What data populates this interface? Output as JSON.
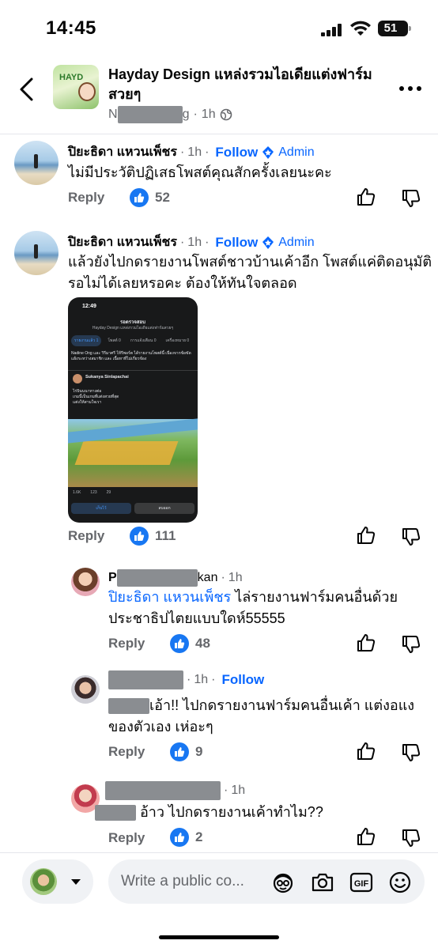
{
  "status_bar": {
    "time": "14:45",
    "battery": "51"
  },
  "header": {
    "title": "Hayday Design แหล่งรวมไอเดียแต่งฟาร์มสวยๆ",
    "author_prefix": "N",
    "author_suffix": "g",
    "time": "1h",
    "avatar_text": "HAYD"
  },
  "comments": [
    {
      "name": "ปิยะธิดา แหวนเพ็ชร",
      "time": "1h",
      "follow": "Follow",
      "badge": "Admin",
      "text": "ไม่มีประวัติปฏิเสธโพสต์คุณสักครั้งเลยนะคะ",
      "reply": "Reply",
      "likes": "52"
    },
    {
      "name": "ปิยะธิดา แหวนเพ็ชร",
      "time": "1h",
      "follow": "Follow",
      "badge": "Admin",
      "text_line1": "แล้วยังไปกดรายงานโพสต์ชาวบ้านเค้าอีก โพสต์แค่ติดอนุมัติ",
      "text_line2": "รอไม่ได้เลยหรอคะ ต้องให้ทันใจตลอด",
      "reply": "Reply",
      "likes": "111"
    }
  ],
  "embedded_screenshot": {
    "time": "12:49",
    "title": "รอตรวจสอบ",
    "subtitle": "Hayday Design แหล่งรวมไอเดียแต่งฟาร์มสวยๆ",
    "tabs": [
      "รายงานแล้ว 1",
      "โพสต์ 0",
      "การแจ้งเตือน 0",
      "เครื่องหมาย 0"
    ],
    "info": "Nadine Ong และ วิรีมาศรี ให้รีพอร์ต ได้รายงานโพสต์นี้ เนื่องจากข้อขัดแย้งระหว่างสมาชิก และ เนื้อหาที่ไม่เกี่ยวข้อง",
    "user": "Sukanya Sinlapachai",
    "post_line1": "ไร่บินนนาทางต่อ",
    "post_line2": "เกมนี้เป็นเกมที่แต่งสวยที่สุด",
    "post_line3": "แต่งให้สามใจเรา",
    "stats": [
      "1.6K",
      "123",
      "29"
    ],
    "keep_label": "เก็บไว้",
    "delete_label": "ลบออก"
  },
  "replies": [
    {
      "name_prefix": "P",
      "name_suffix": "kan",
      "time": "1h",
      "mention": "ปิยะธิดา แหวนเพ็ชร",
      "text_line1": " ไล่รายงานฟาร์มคนอื่นด้วย",
      "text_line2": "ประชาธิปไตยแบบใดห์55555",
      "reply": "Reply",
      "likes": "48"
    },
    {
      "time": "1h",
      "follow": "Follow",
      "text_line1": "เอ้า!! ไปกดรายงานฟาร์มคนอื่นเค้า แต่งอแง",
      "text_line2": "ของตัวเอง เห่อะๆ",
      "reply": "Reply",
      "likes": "9"
    },
    {
      "time": "1h",
      "text_line1": " อ้าว ไปกดรายงานเค้าทำไม??",
      "reply": "Reply",
      "likes": "2"
    }
  ],
  "composer": {
    "placeholder": "Write a public co..."
  },
  "icons": {
    "back": "chevron-left-icon",
    "more": "more-horizontal-icon",
    "globe": "globe-icon",
    "admin": "admin-shield-icon",
    "like": "thumbs-up-icon",
    "dislike": "thumbs-down-icon",
    "avatar_sticker": "avatar-sticker-icon",
    "camera": "camera-icon",
    "gif": "gif-icon",
    "emoji": "emoji-icon"
  },
  "colors": {
    "accent": "#0866ff",
    "like_blue": "#1877f2",
    "muted": "#65676b",
    "divider": "#e4e6eb"
  }
}
